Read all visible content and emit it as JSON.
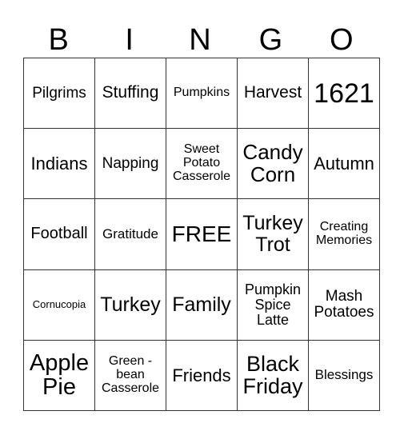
{
  "header": [
    "B",
    "I",
    "N",
    "G",
    "O"
  ],
  "rows": [
    [
      {
        "text": "Pilgrims",
        "size": 19
      },
      {
        "text": "Stuffing",
        "size": 21
      },
      {
        "text": "Pumpkins",
        "size": 16
      },
      {
        "text": "Harvest",
        "size": 21
      },
      {
        "text": "1621",
        "size": 34
      }
    ],
    [
      {
        "text": "Indians",
        "size": 22
      },
      {
        "text": "Napping",
        "size": 19
      },
      {
        "text": "Sweet\nPotato\nCasserole",
        "size": 16
      },
      {
        "text": "Candy\nCorn",
        "size": 26
      },
      {
        "text": "Autumn",
        "size": 22
      }
    ],
    [
      {
        "text": "Football",
        "size": 20
      },
      {
        "text": "Gratitude",
        "size": 17
      },
      {
        "text": "FREE",
        "size": 28
      },
      {
        "text": "Turkey\nTrot",
        "size": 25
      },
      {
        "text": "Creating\nMemories",
        "size": 16
      }
    ],
    [
      {
        "text": "Cornucopia",
        "size": 13
      },
      {
        "text": "Turkey",
        "size": 25
      },
      {
        "text": "Family",
        "size": 25
      },
      {
        "text": "Pumpkin\nSpice\nLatte",
        "size": 18
      },
      {
        "text": "Mash\nPotatoes",
        "size": 19
      }
    ],
    [
      {
        "text": "Apple\nPie",
        "size": 29
      },
      {
        "text": "Green -\nbean\nCasserole",
        "size": 16
      },
      {
        "text": "Friends",
        "size": 22
      },
      {
        "text": "Black\nFriday",
        "size": 27
      },
      {
        "text": "Blessings",
        "size": 17
      }
    ]
  ]
}
